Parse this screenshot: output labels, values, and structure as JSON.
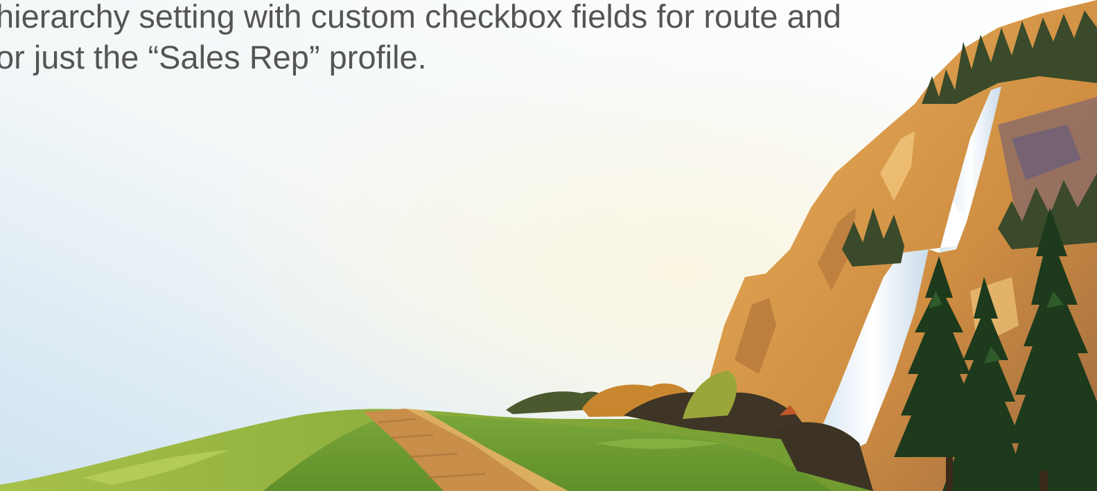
{
  "slide": {
    "body_text": "hierarchy setting with custom checkbox fields for route and\nor just the “Sales Rep” profile."
  },
  "palette": {
    "text": "#555555",
    "sky": "#dceaf3",
    "grass": "#6a9a2e",
    "path": "#c98e4a",
    "cliff": "#d99a4a",
    "waterfall": "#f2f6fb",
    "trees": "#1d3a1c"
  },
  "illustration": {
    "elements": [
      "grassy-hill",
      "dirt-path",
      "rocky-cliff",
      "waterfall",
      "pine-trees",
      "shrubs"
    ]
  }
}
